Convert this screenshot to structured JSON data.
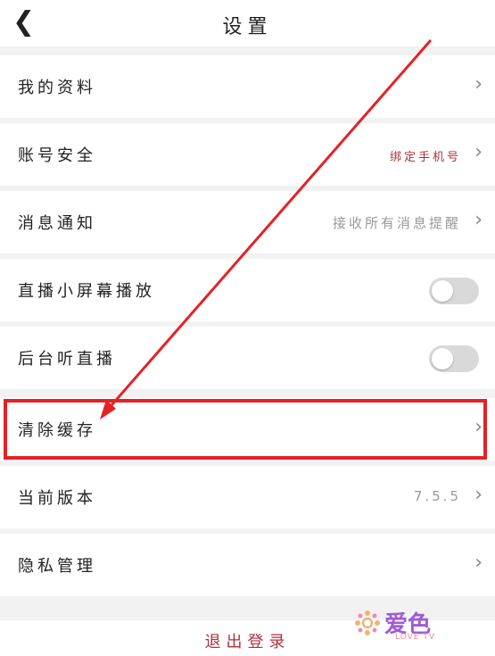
{
  "header": {
    "title": "设置",
    "back_icon": "chevron-left-icon"
  },
  "rows": [
    {
      "label": "我的资料",
      "value": "",
      "type": "link"
    },
    {
      "label": "账号安全",
      "value": "绑定手机号",
      "type": "link"
    },
    {
      "label": "消息通知",
      "value": "接收所有消息提醒",
      "type": "link"
    },
    {
      "label": "直播小屏幕播放",
      "type": "toggle",
      "on": false
    },
    {
      "label": "后台听直播",
      "type": "toggle",
      "on": false
    },
    {
      "label": "清除缓存",
      "value": "",
      "type": "link"
    },
    {
      "label": "当前版本",
      "value": "7.5.5",
      "type": "link"
    },
    {
      "label": "隐私管理",
      "value": "",
      "type": "link"
    }
  ],
  "logout": {
    "label": "退出登录"
  },
  "watermark": {
    "text": "爱色",
    "sub": "LOVE TV"
  },
  "colors": {
    "highlight": "#e42226",
    "accent_text": "#b0303a",
    "toggle_off": "#d9d9d9"
  }
}
